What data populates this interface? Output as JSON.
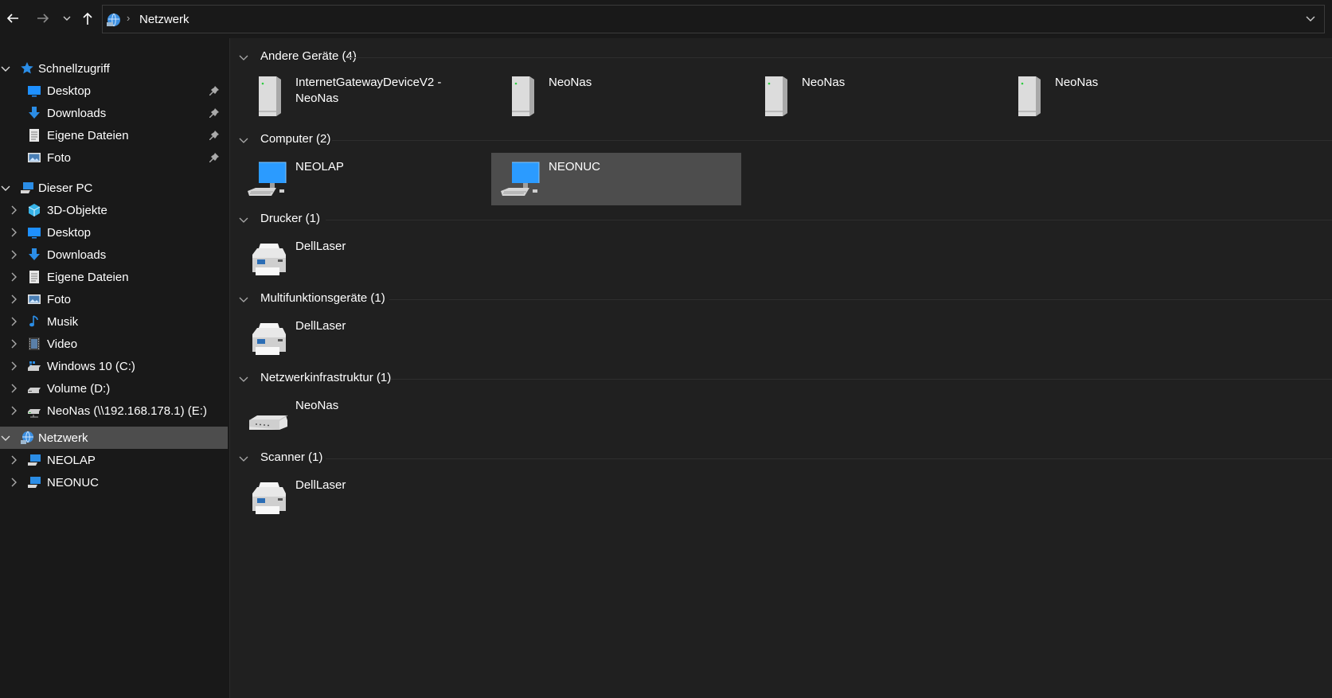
{
  "toolbar": {
    "back_icon": "arrow-left-icon",
    "forward_icon": "arrow-right-icon",
    "recent_icon": "chevron-down-icon",
    "up_icon": "arrow-up-icon"
  },
  "address": {
    "icon": "network-icon",
    "path": "Netzwerk"
  },
  "sidebar": {
    "quick_access": {
      "label": "Schnellzugriff",
      "items": [
        {
          "label": "Desktop",
          "icon": "desktop-icon",
          "pinned": true
        },
        {
          "label": "Downloads",
          "icon": "download-icon",
          "pinned": true
        },
        {
          "label": "Eigene Dateien",
          "icon": "document-icon",
          "pinned": true
        },
        {
          "label": "Foto",
          "icon": "picture-icon",
          "pinned": true
        }
      ]
    },
    "this_pc": {
      "label": "Dieser PC",
      "items": [
        {
          "label": "3D-Objekte",
          "icon": "cube-icon"
        },
        {
          "label": "Desktop",
          "icon": "desktop-icon"
        },
        {
          "label": "Downloads",
          "icon": "download-icon"
        },
        {
          "label": "Eigene Dateien",
          "icon": "document-icon"
        },
        {
          "label": "Foto",
          "icon": "picture-icon"
        },
        {
          "label": "Musik",
          "icon": "music-icon"
        },
        {
          "label": "Video",
          "icon": "video-icon"
        },
        {
          "label": "Windows 10 (C:)",
          "icon": "drive-windows-icon"
        },
        {
          "label": "Volume (D:)",
          "icon": "drive-icon"
        },
        {
          "label": "NeoNas (\\\\192.168.178.1) (E:)",
          "icon": "network-drive-icon"
        }
      ]
    },
    "network": {
      "label": "Netzwerk",
      "items": [
        {
          "label": "NEOLAP",
          "icon": "computer-icon"
        },
        {
          "label": "NEONUC",
          "icon": "computer-icon"
        }
      ]
    }
  },
  "groups": [
    {
      "title": "Andere Geräte (4)",
      "items": [
        {
          "label": "InternetGatewayDeviceV2 - NeoNas",
          "icon": "server-icon"
        },
        {
          "label": "NeoNas",
          "icon": "server-icon"
        },
        {
          "label": "NeoNas",
          "icon": "server-icon"
        },
        {
          "label": "NeoNas",
          "icon": "server-icon"
        }
      ]
    },
    {
      "title": "Computer (2)",
      "items": [
        {
          "label": "NEOLAP",
          "icon": "computer-icon"
        },
        {
          "label": "NEONUC",
          "icon": "computer-icon",
          "selected": true
        }
      ]
    },
    {
      "title": "Drucker (1)",
      "items": [
        {
          "label": "DellLaser",
          "icon": "printer-icon"
        }
      ]
    },
    {
      "title": "Multifunktionsgeräte (1)",
      "items": [
        {
          "label": "DellLaser",
          "icon": "printer-icon"
        }
      ]
    },
    {
      "title": "Netzwerkinfrastruktur (1)",
      "items": [
        {
          "label": "NeoNas",
          "icon": "router-icon"
        }
      ]
    },
    {
      "title": "Scanner (1)",
      "items": [
        {
          "label": "DellLaser",
          "icon": "printer-icon"
        }
      ]
    }
  ],
  "colors": {
    "background": "#202020",
    "sidebar": "#191919",
    "selection": "#4d4d4d",
    "accent": "#1e90ff"
  }
}
